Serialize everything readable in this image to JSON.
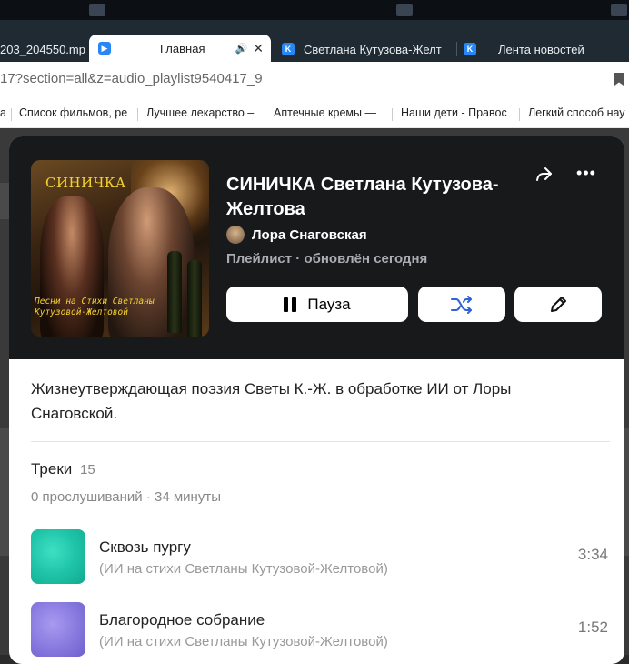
{
  "browser": {
    "tabs": [
      {
        "label": "203_204550.mp",
        "icon": "file-icon"
      },
      {
        "label": "Главная",
        "icon": "play-icon",
        "active": true
      },
      {
        "label": "Светлана Кутузова-Желт",
        "icon": "vk-icon"
      },
      {
        "label": "Лента новостей",
        "icon": "vk-icon"
      }
    ],
    "url": "17?section=all&z=audio_playlist9540417_9",
    "bookmarks": [
      "a",
      "Список фильмов, ре",
      "Лучшее лекарство –",
      "Аптечные кремы — ",
      "Наши дети - Правос",
      "Легкий способ нау"
    ]
  },
  "playlist": {
    "cover": {
      "title": "СИНИЧКА",
      "subtitle": "Песни на Стихи Светланы Кутузовой-Желтовой"
    },
    "title": "СИНИЧКА Светлана Кутузова-Желтова",
    "author": "Лора Снаговская",
    "meta": "Плейлист · обновлён сегодня",
    "pause_label": "Пауза",
    "description": "Жизнеутверждающая поэзия Светы К.-Ж. в обработке ИИ от Лоры Снаговской.",
    "tracks_heading": "Треки",
    "tracks_count": "15",
    "stats": "0 прослушиваний · 34 минуты",
    "tracks": [
      {
        "name": "Сквозь пургу",
        "subtitle": "(ИИ на стихи Светланы Кутузовой-Желтовой)",
        "duration": "3:34"
      },
      {
        "name": "Благородное собрание",
        "subtitle": "(ИИ на стихи Светланы Кутузовой-Желтовой)",
        "duration": "1:52"
      }
    ]
  },
  "colors": {
    "accent": "#2c63d6",
    "header_bg": "#17191b",
    "track1_thumb": "#1fc4a8",
    "track2_thumb": "#8a7be0"
  }
}
